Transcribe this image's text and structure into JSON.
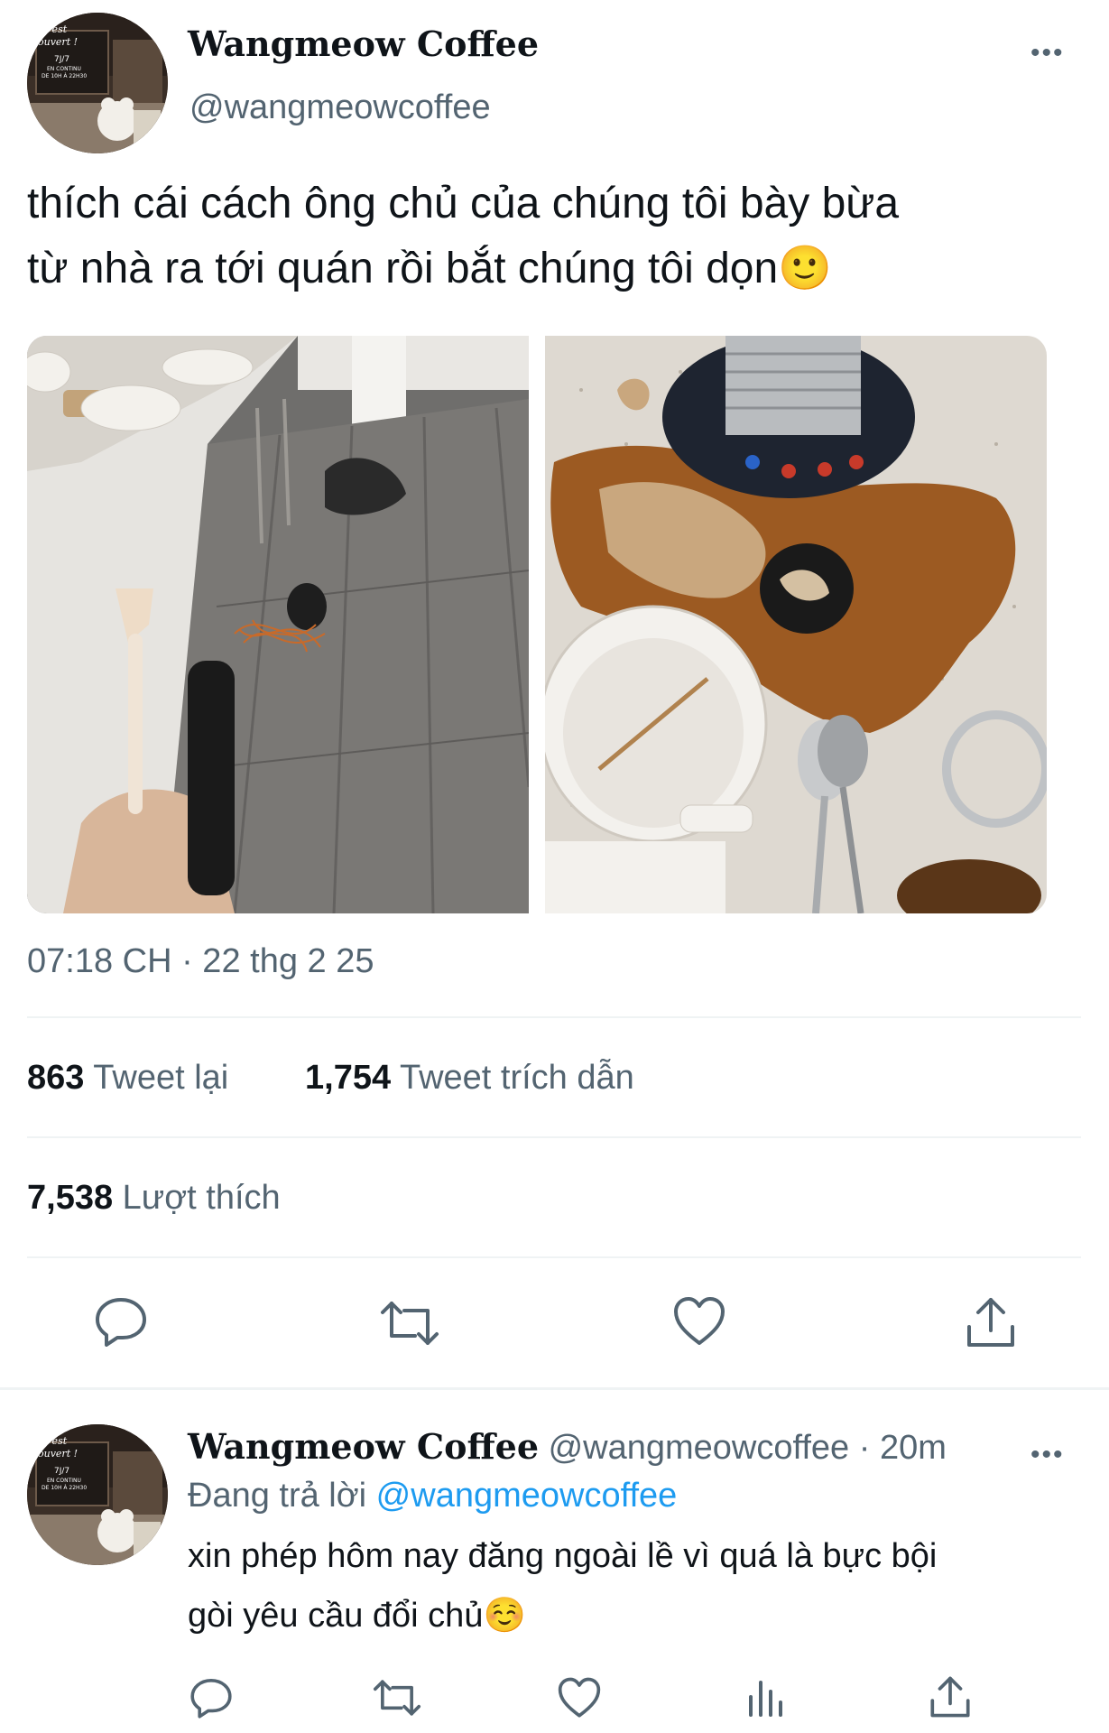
{
  "tweet": {
    "display_name": "Wangmeow Coffee",
    "handle": "@wangmeowcoffee",
    "text_line1": "thích cái cách ông chủ của chúng tôi bày bừa",
    "text_line2": "từ nhà ra tới quán rồi bắt chúng tôi dọn",
    "emoji": "🙂",
    "timestamp": "07:18 CH · 22 thg 2 25",
    "retweets_count": "863",
    "retweets_label": "Tweet lại",
    "quotes_count": "1,754",
    "quotes_label": "Tweet trích dẫn",
    "likes_count": "7,538",
    "likes_label": "Lượt thích",
    "more": "•••",
    "avatar_sign_lines": [
      "st est",
      "ouvert !",
      "7J/7",
      "EN CONTINU",
      "DE 10H À 22H30"
    ]
  },
  "reply": {
    "display_name": "Wangmeow Coffee",
    "handle": "@wangmeowcoffee",
    "separator": "·",
    "time": "20m",
    "replying_prefix": "Đang trả lời",
    "replying_to": "@wangmeowcoffee",
    "text_line1": "xin phép hôm nay đăng ngoài lề vì quá là bực bội",
    "text_line2": "gòi yêu cầu đổi chủ",
    "emoji": "☺️",
    "more": "•••"
  },
  "icons": {
    "reply": "reply-icon",
    "retweet": "retweet-icon",
    "like": "heart-icon",
    "share": "share-icon",
    "analytics": "analytics-icon",
    "more": "more-icon"
  },
  "colors": {
    "text": "#0f1419",
    "secondary": "#536471",
    "link": "#1d9bf0",
    "divider": "#eff3f4"
  }
}
